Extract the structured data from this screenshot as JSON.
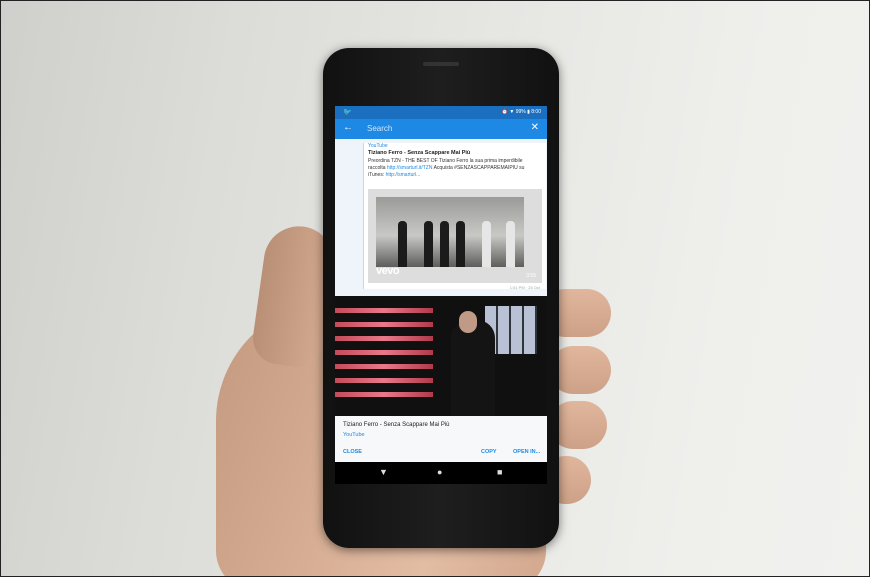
{
  "status_bar": {
    "app_icon": "twitter-bird-icon",
    "right": "⏰ ▼ 99% ▮ 8:00"
  },
  "app_bar": {
    "back_icon": "arrow-left-icon",
    "search_placeholder": "Search",
    "close_icon": "close-icon"
  },
  "tweet": {
    "source": "YouTube",
    "title": "Tiziano Ferro - Senza Scappare Mai Più",
    "body_text": "Preordina TZN - THE BEST OF Tiziano Ferro la sua prima imperdibile raccolta",
    "link1": "http://smarturl.it/TZN",
    "body_text2": "Acquista #SENZASCAPPAREMAIPIU su iTunes:",
    "link2": "http://smarturl...",
    "video_logo": "vevo",
    "duration": "3:55",
    "timestamp": "1:51 PM · 25 Oct"
  },
  "sheet": {
    "title": "Tiziano Ferro - Senza Scappare Mai Più",
    "source": "YouTube",
    "close_label": "CLOSE",
    "copy_label": "COPY",
    "open_label": "OPEN IN..."
  },
  "navbar": {
    "back": "▼",
    "home": "●",
    "recents": "■"
  }
}
